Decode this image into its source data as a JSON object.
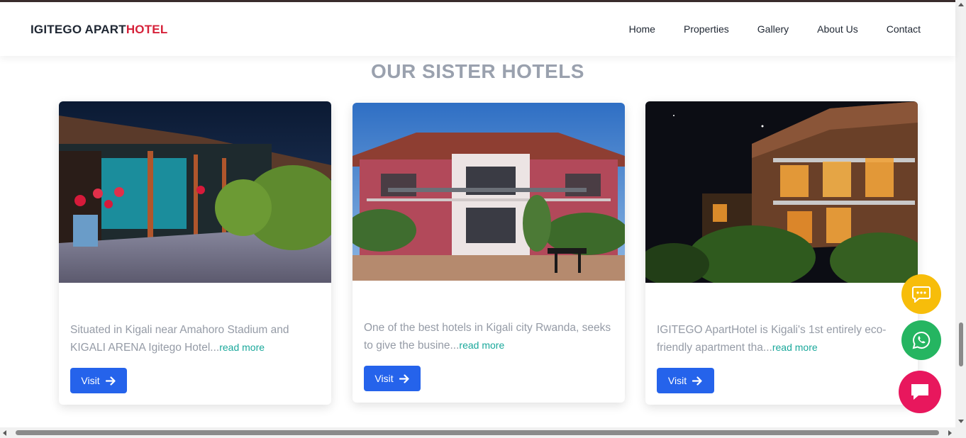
{
  "brand": {
    "name_main": "IGITEGO APART",
    "name_accent": "HOTEL"
  },
  "nav": {
    "items": [
      {
        "label": "Home"
      },
      {
        "label": "Properties"
      },
      {
        "label": "Gallery"
      },
      {
        "label": "About Us"
      },
      {
        "label": "Contact"
      }
    ]
  },
  "section": {
    "title": "OUR SISTER HOTELS"
  },
  "hotels": [
    {
      "photo": "night courtyard patio with flowers and hanging lights",
      "description": "Situated in Kigali near Amahoro Stadium and KIGALI ARENA Igitego Hotel...",
      "read_more": "read more",
      "button": "Visit"
    },
    {
      "photo": "two-storey pink brick hotel with balconies under blue sky",
      "description": "One of the best hotels in Kigali city Rwanda, seeks to give the busine...",
      "read_more": "read more",
      "button": "Visit"
    },
    {
      "photo": "lit apartment building with balconies at night",
      "description": "IGITEGO ApartHotel is Kigali's 1st entirely eco-friendly apartment tha...",
      "read_more": "read more",
      "button": "Visit"
    }
  ],
  "floating_buttons": [
    {
      "icon": "chat-bubble-icon",
      "color": "#f7bd0a"
    },
    {
      "icon": "whatsapp-icon",
      "color": "#25b561"
    },
    {
      "icon": "message-icon",
      "color": "#e8175d"
    }
  ],
  "colors": {
    "brand_accent": "#d6223a",
    "button": "#2563eb",
    "link": "#1aa89b"
  }
}
